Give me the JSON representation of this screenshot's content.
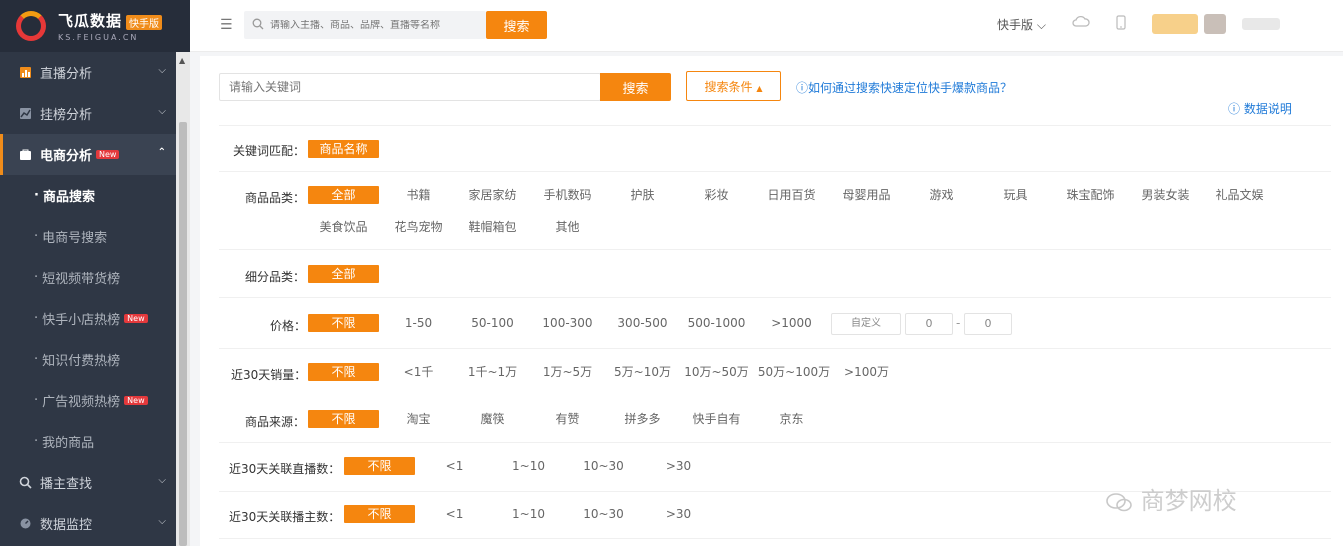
{
  "brand": {
    "name": "飞瓜数据",
    "badge": "快手版",
    "domain": "KS.FEIGUA.CN"
  },
  "sidebar": {
    "items": [
      {
        "label": "直播分析",
        "icon": "bar-chart-icon"
      },
      {
        "label": "挂榜分析",
        "icon": "trend-icon"
      },
      {
        "label": "电商分析",
        "icon": "bag-icon",
        "tag": "New"
      }
    ],
    "sub": [
      {
        "label": "商品搜索"
      },
      {
        "label": "电商号搜索"
      },
      {
        "label": "短视频带货榜"
      },
      {
        "label": "快手小店热榜",
        "tag": "New"
      },
      {
        "label": "知识付费热榜"
      },
      {
        "label": "广告视频热榜",
        "tag": "New"
      },
      {
        "label": "我的商品"
      }
    ],
    "bottom": [
      {
        "label": "播主查找",
        "icon": "search-icon"
      },
      {
        "label": "数据监控",
        "icon": "monitor-icon"
      }
    ]
  },
  "topbar": {
    "search_placeholder": "请输入主播、商品、品牌、直播等名称",
    "search_button": "搜索",
    "version_label": "快手版"
  },
  "main": {
    "keyword_placeholder": "请输入关键词",
    "search_button": "搜索",
    "condition_button": "搜索条件",
    "help_link": "如何通过搜索快速定位快手爆款商品？",
    "data_note": "数据说明"
  },
  "filters": {
    "keyword_match": {
      "label": "关键词匹配：",
      "options": [
        "商品名称"
      ]
    },
    "category": {
      "label": "商品品类：",
      "options": [
        "全部",
        "书籍",
        "家居家纺",
        "手机数码",
        "护肤",
        "彩妆",
        "日用百货",
        "母婴用品",
        "游戏",
        "玩具",
        "珠宝配饰",
        "男装女装",
        "礼品文娱",
        "美食饮品",
        "花鸟宠物",
        "鞋帽箱包",
        "其他"
      ]
    },
    "subcategory": {
      "label": "细分品类：",
      "options": [
        "全部"
      ]
    },
    "price": {
      "label": "价格：",
      "options": [
        "不限",
        "1-50",
        "50-100",
        "100-300",
        "300-500",
        "500-1000",
        ">1000"
      ],
      "custom": {
        "button": "自定义",
        "min": "0",
        "separator": "-",
        "max": "0"
      }
    },
    "sales_30d": {
      "label": "近30天销量：",
      "options": [
        "不限",
        "<1千",
        "1千~1万",
        "1万~5万",
        "5万~10万",
        "10万~50万",
        "50万~100万",
        ">100万"
      ]
    },
    "source": {
      "label": "商品来源：",
      "options": [
        "不限",
        "淘宝",
        "魔筷",
        "有赞",
        "拼多多",
        "快手自有",
        "京东"
      ]
    },
    "live_count_30d": {
      "label": "近30天关联直播数：",
      "options": [
        "不限",
        "<1",
        "1~10",
        "10~30",
        ">30"
      ]
    },
    "streamer_count_30d": {
      "label": "近30天关联播主数：",
      "options": [
        "不限",
        "<1",
        "1~10",
        "10~30",
        ">30"
      ]
    }
  },
  "watermark": "商梦网校",
  "colors": {
    "accent": "#f5860f",
    "sidebar": "#2f3745",
    "link": "#1f7ad8"
  }
}
